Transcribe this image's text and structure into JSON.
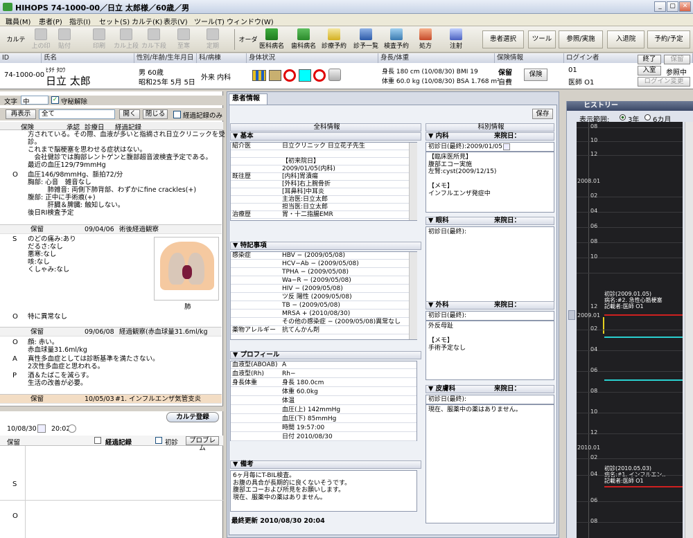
{
  "window": {
    "title": "HIHOPS 74-1000-00／日立 太郎様／60歳／男",
    "btn_min": "_",
    "btn_max": "▢",
    "btn_close": "✕"
  },
  "menu": [
    "職員(M)",
    "患者(P)",
    "指示(I)",
    "セット(S)",
    "カルテ(K)",
    "表示(V)",
    "ツール(T)",
    "ウィンドウ(W)"
  ],
  "toolbar": {
    "karte": "カルテ",
    "disabled": [
      "上の印",
      "貼付",
      "印刷",
      "カル上段",
      "カル下段",
      "至寒",
      "定期"
    ],
    "order_label": "オーダ",
    "orders": [
      "医科病名",
      "歯科病名",
      "診療予約",
      "診予一覧",
      "検査予約",
      "処方",
      "注射"
    ],
    "right_buttons": [
      "患者選択",
      "ツール",
      "参照/実施",
      "入退院",
      "予約/予定"
    ]
  },
  "patient_info": {
    "headers": {
      "id": "ID",
      "name": "氏名",
      "sex_age_dob": "性別/年齢/生年月日",
      "dept_ward": "科/病棟",
      "condition": "身体状況",
      "height_weight": "身長/体重",
      "insurance": "保険情報",
      "login": "ログイン者"
    },
    "id": "74-1000-00",
    "kana": "ﾋﾀﾁ ﾀﾛｳ",
    "name": "日立 太郎",
    "sex_age": "男 60歳",
    "dob": "昭和25年 5月 5日",
    "dept": "外来 内科",
    "height": "身長 180 cm (10/08/30) BMI 19",
    "weight": "体重 60.0 kg (10/08/30) BSA 1.768 m²",
    "insurance_status": "保留",
    "insurance_type": "自費",
    "insurance_button": "保険",
    "login_no": "01",
    "login_user": "医師 O1",
    "btn_end": "終了",
    "btn_hold": "保留",
    "btn_enter": "入室",
    "ref_status": "参照中",
    "btn_login_change": "ログイン変更",
    "condition_colors": {
      "cyan": "#00ffff",
      "red": "#e00000"
    }
  },
  "left": {
    "font_label": "文字",
    "font_size": "中",
    "protect_label": "守秘解除",
    "btn_redisplay": "再表示",
    "filter": "全て",
    "btn_open": "開く",
    "btn_close": "閉じる",
    "chk_progress_only": "経過記録のみ",
    "cols": {
      "hold": "保険",
      "approve": "承認",
      "date": "診療日",
      "record": "経過記録"
    },
    "entry0_s_text": "方されている。その際、血液が多いと指摘され日立クリニックを受\n診。\nこれまで脳梗塞を思わせる症状はない。\n　会社健診では胸部レントゲンと腹部超音波検査予定である。\n最近の血圧129/79mmHg",
    "entry0_o_label": "O",
    "entry0_o_text": "血圧146/98mmHg、脈拍72/分\n胸部: 心音　雑音なし\n　　　肺雑音: 両側下肺背部、わずかにfine crackles(+)\n腹部: 正中に手術痕(+)\n　　　肝臓＆脾臓: 触知しない。\n後日RI検査予定",
    "entry1": {
      "status": "保留",
      "date": "09/04/06",
      "title": "術後経過観察"
    },
    "entry1_s_label": "S",
    "entry1_s_text": "のどの痛み:あり\nだるさ:なし\n悪寒:なし\n咳:なし\nくしゃみ:なし",
    "entry1_img_caption": "肺",
    "entry1_o_label": "O",
    "entry1_o_text": "特に異常なし",
    "entry2": {
      "status": "保留",
      "date": "09/06/08",
      "title": "経過観察(赤血球量31.6ml/kg"
    },
    "entry2_o_label": "O",
    "entry2_o_text": "顔: 赤い。\n赤血球量31.6ml/kg",
    "entry2_a_label": "A",
    "entry2_a_text": "真性多血症としては診断基準を満たさない。\n2次性多血症と思われる。",
    "entry2_p_label": "P",
    "entry2_p_text": "酒＆たばこを減らす。\n生活の改善が必要。",
    "entry3": {
      "status": "保留",
      "date": "10/05/03",
      "title": "#1. インフルエンザ気管支炎"
    },
    "karte_register": "カルテ登録",
    "new_date": "10/08/30",
    "new_time": "20:02",
    "new_status": "保留",
    "new_record_label": "経過記録",
    "new_first_visit": "初診",
    "btn_problem": "プロブレム",
    "soap_s": "S",
    "soap_o": "O"
  },
  "center": {
    "tab": "患者情報",
    "btn_save": "保存",
    "all_dept_header": "全科情報",
    "by_dept_header": "科別情報",
    "sec_basic": "▼ 基本",
    "basic_rows": [
      {
        "label": "紹介医",
        "value": "日立クリニック 日立花子先生"
      },
      {
        "label": "",
        "value": ""
      },
      {
        "label": "",
        "value": "【初来院日】"
      },
      {
        "label": "",
        "value": "2009/01/05(内科)"
      },
      {
        "label": "既往歴",
        "value": "[内科]胃潰瘍"
      },
      {
        "label": "",
        "value": "[外科]右上腕骨折"
      },
      {
        "label": "",
        "value": "[耳鼻科]中耳炎"
      },
      {
        "label": "",
        "value": "主治医:日立太郎"
      },
      {
        "label": "",
        "value": "担当医:日立太郎"
      },
      {
        "label": "治療歴",
        "value": "胃・十二指腸EMR"
      }
    ],
    "sec_special": "▼ 特記事項",
    "special_rows": [
      {
        "label": "感染症",
        "value": "HBV − (2009/05/08)"
      },
      {
        "label": "",
        "value": "HCV−Ab − (2009/05/08)"
      },
      {
        "label": "",
        "value": "TPHA − (2009/05/08)"
      },
      {
        "label": "",
        "value": "Wa−R − (2009/05/08)"
      },
      {
        "label": "",
        "value": "HIV − (2009/05/08)"
      },
      {
        "label": "",
        "value": "ツ反 陽性 (2009/05/08)"
      },
      {
        "label": "",
        "value": "TB − (2009/05/08)"
      },
      {
        "label": "",
        "value": "MRSA + (2010/08/30)"
      },
      {
        "label": "",
        "value": "その他の感染症 − (2009/05/08)異常なし"
      },
      {
        "label": "薬物アレルギー",
        "value": "抗てんかん剤"
      }
    ],
    "sec_profile": "▼ プロフィール",
    "profile_rows": [
      {
        "label": "血液型(ABOAB)",
        "value": "A"
      },
      {
        "label": "血液型(Rh)",
        "value": "Rh−"
      },
      {
        "label": "身長体重",
        "value": "身長 180.0cm"
      },
      {
        "label": "",
        "value": "体重 60.0kg"
      },
      {
        "label": "",
        "value": "体温"
      },
      {
        "label": "",
        "value": "血圧(上) 142mmHg"
      },
      {
        "label": "",
        "value": "血圧(下) 85mmHg"
      },
      {
        "label": "",
        "value": "時間 19:57:00"
      },
      {
        "label": "",
        "value": "日付 2010/08/30"
      }
    ],
    "sec_remarks": "▼ 備考",
    "remarks": "6ヶ月毎にT-BIL検査。\nお腹の具合が長期的に良くないそうです。\n腹部エコーおよび所見をお願いします。\n現在、服薬中の薬はありません。",
    "last_update": "最終更新 2010/08/30 20:04",
    "internal": {
      "title": "▼ 内科",
      "visit_label": "来院日：",
      "first_visit": "初診日(最終):2009/01/05",
      "text": "【臨床医所見】\n腹部エコー実施\n左腎:cyst(2009/12/15)\n\n【メモ】\nインフルエンザ発症中"
    },
    "eye": {
      "title": "▼ 眼科",
      "visit_label": "来院日：",
      "first_visit": "初診日(最終):",
      "text": ""
    },
    "surgery": {
      "title": "▼ 外科",
      "visit_label": "来院日：",
      "first_visit": "初診日(最終):",
      "text": "外反母趾\n\n【メモ】\n手術予定なし"
    },
    "derm": {
      "title": "▼ 皮膚科",
      "visit_label": "来院日：",
      "first_visit": "初診日(最終):",
      "text": "現在、服薬中の薬はありません。"
    }
  },
  "history": {
    "title": "ヒストリー",
    "range_label": "表示範囲:",
    "opt_3y": "3年",
    "opt_6m": "6カ月",
    "year_2008": "2008.01",
    "year_2009": "2009.01",
    "year_2010": "2010.01",
    "months": [
      "08",
      "10",
      "12",
      "02",
      "04",
      "06",
      "08",
      "10",
      "12",
      "02",
      "04",
      "06",
      "08",
      "10",
      "12",
      "02",
      "04",
      "06",
      "08"
    ],
    "event1": "初診(2009.01.05)\n病名:#2. 急性心筋梗塞\n記載者:医師 O1",
    "event2": "初診(2010.05.03)\n病名:#1. インフルエン..\n記載者:医師 O1",
    "colors": {
      "cyan": "#2ad0d0",
      "yellow": "#e6d020",
      "red": "#d02020"
    }
  }
}
